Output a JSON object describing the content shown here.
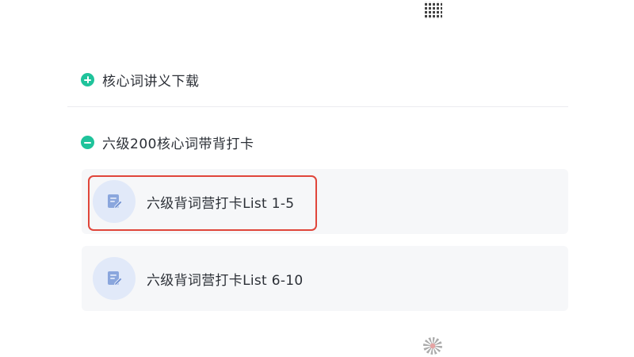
{
  "sections": [
    {
      "title": "核心词讲义下载",
      "expanded": false,
      "icon": "plus-circle-icon"
    },
    {
      "title": "六级200核心词带背打卡",
      "expanded": true,
      "icon": "minus-circle-icon"
    }
  ],
  "cards": [
    {
      "title": "六级背词营打卡List 1-5",
      "icon": "document-edit-icon",
      "highlighted": true
    },
    {
      "title": "六级背词营打卡List 6-10",
      "icon": "document-edit-icon",
      "highlighted": false
    }
  ],
  "colors": {
    "accent": "#1fc39b",
    "highlight": "#e0463b",
    "card_bg": "#f6f7f9",
    "icon_bg": "#e1e9f9",
    "icon_fg": "#8aa6dd"
  }
}
